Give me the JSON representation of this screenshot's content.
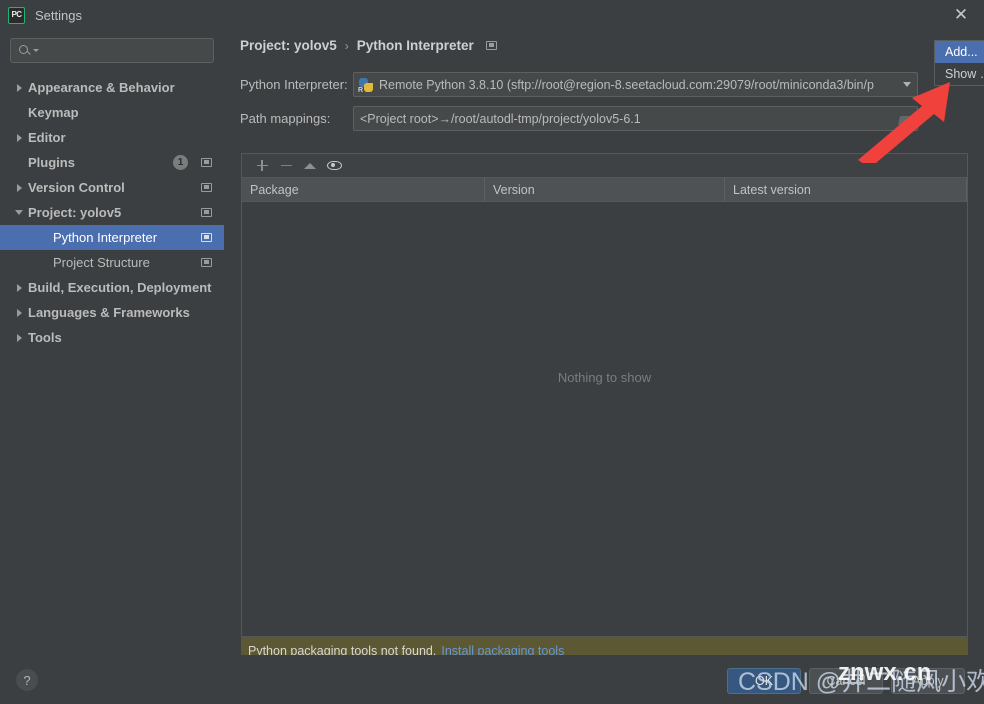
{
  "window": {
    "title": "Settings",
    "logo_text": "PC",
    "close_icon": "close-icon"
  },
  "sidebar": {
    "search": {
      "value": "",
      "placeholder": ""
    },
    "items": [
      {
        "label": "Appearance & Behavior",
        "twisty": "right",
        "bold": true,
        "badge": null,
        "copy": false,
        "selected": false,
        "child": false
      },
      {
        "label": "Keymap",
        "twisty": "none",
        "bold": true,
        "badge": null,
        "copy": false,
        "selected": false,
        "child": false
      },
      {
        "label": "Editor",
        "twisty": "right",
        "bold": true,
        "badge": null,
        "copy": false,
        "selected": false,
        "child": false
      },
      {
        "label": "Plugins",
        "twisty": "none",
        "bold": true,
        "badge": "1",
        "copy": true,
        "selected": false,
        "child": false
      },
      {
        "label": "Version Control",
        "twisty": "right",
        "bold": true,
        "badge": null,
        "copy": true,
        "selected": false,
        "child": false
      },
      {
        "label": "Project: yolov5",
        "twisty": "down",
        "bold": true,
        "badge": null,
        "copy": true,
        "selected": false,
        "child": false
      },
      {
        "label": "Python Interpreter",
        "twisty": "none",
        "bold": false,
        "badge": null,
        "copy": true,
        "selected": true,
        "child": true
      },
      {
        "label": "Project Structure",
        "twisty": "none",
        "bold": false,
        "badge": null,
        "copy": true,
        "selected": false,
        "child": true
      },
      {
        "label": "Build, Execution, Deployment",
        "twisty": "right",
        "bold": true,
        "badge": null,
        "copy": false,
        "selected": false,
        "child": false
      },
      {
        "label": "Languages & Frameworks",
        "twisty": "right",
        "bold": true,
        "badge": null,
        "copy": false,
        "selected": false,
        "child": false
      },
      {
        "label": "Tools",
        "twisty": "right",
        "bold": true,
        "badge": null,
        "copy": false,
        "selected": false,
        "child": false
      }
    ]
  },
  "content": {
    "breadcrumb": {
      "root": "Project: yolov5",
      "separator": "›",
      "leaf": "Python Interpreter"
    },
    "interpreter": {
      "label": "Python Interpreter:",
      "value": "Remote Python 3.8.10 (sftp://root@region-8.seetacloud.com:29079/root/miniconda3/bin/p",
      "icon": "python-remote-icon"
    },
    "path_mappings": {
      "label": "Path mappings:",
      "value": "<Project root>→/root/autodl-tmp/project/yolov5-6.1"
    },
    "add_menu": {
      "items": [
        {
          "label": "Add...",
          "selected": true
        },
        {
          "label": "Show …",
          "selected": false
        }
      ]
    },
    "packages": {
      "toolbar": [
        {
          "name": "add-package-icon",
          "glyph": "plus"
        },
        {
          "name": "remove-package-icon",
          "glyph": "minus"
        },
        {
          "name": "upgrade-package-icon",
          "glyph": "up"
        },
        {
          "name": "show-early-releases-icon",
          "glyph": "eye"
        }
      ],
      "columns": [
        "Package",
        "Version",
        "Latest version"
      ],
      "rows": [],
      "empty_text": "Nothing to show"
    },
    "status": {
      "message": "Python packaging tools not found.",
      "link": "Install packaging tools"
    }
  },
  "footer": {
    "help_label": "?",
    "buttons": [
      {
        "label": "OK",
        "primary": true
      },
      {
        "label": "Cancel",
        "primary": false
      },
      {
        "label": "Apply",
        "primary": false
      }
    ]
  },
  "watermark": {
    "csdn": "CSDN @井二随风小欢",
    "site": "znwx.cn"
  },
  "annotation": {
    "arrow_color": "#f0413c",
    "points_to": "Add..."
  }
}
